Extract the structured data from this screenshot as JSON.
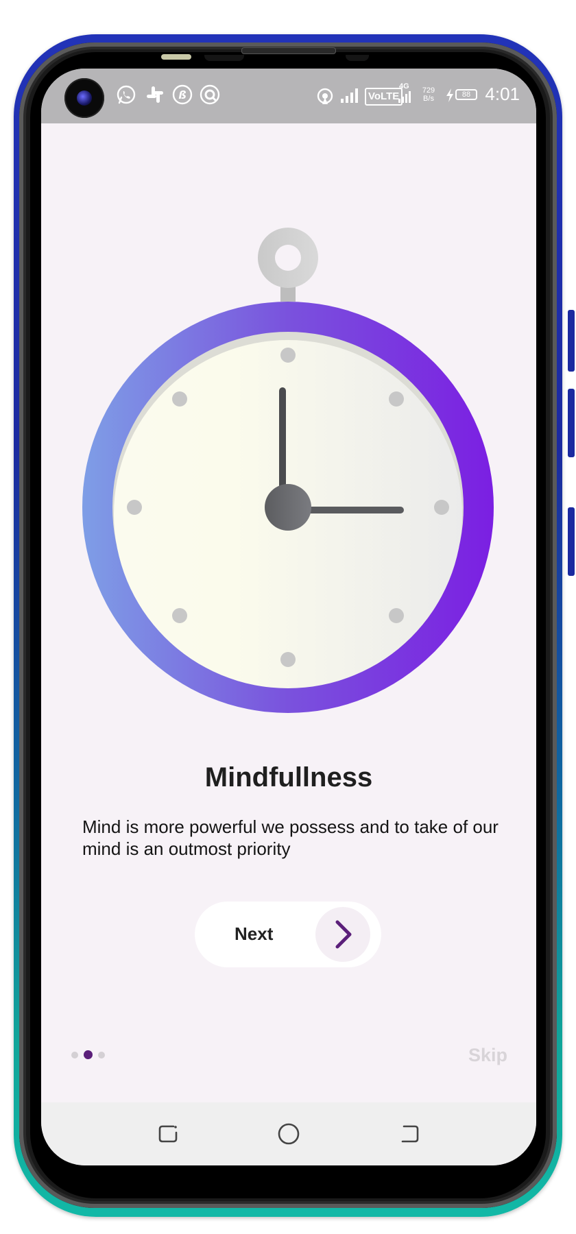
{
  "status_bar": {
    "time": "4:01",
    "network_speed_value": "729",
    "network_speed_unit": "B/s",
    "battery_level": "88",
    "network_type": "4G",
    "volte_label": "VoLTE",
    "notification_icons": [
      "whatsapp-icon",
      "slack-icon",
      "bitcoin-icon",
      "app-icon"
    ]
  },
  "onboarding": {
    "illustration": "stopwatch-icon",
    "title": "Mindfullness",
    "description": "Mind is more powerful we possess and to take of our mind is an outmost priority",
    "next_label": "Next",
    "skip_label": "Skip",
    "page_count": 3,
    "active_page": 2
  },
  "colors": {
    "accent": "#5b1f7a",
    "ring_start": "#7e9ee6",
    "ring_end": "#7b1fe2",
    "background": "#f7f2f7"
  }
}
